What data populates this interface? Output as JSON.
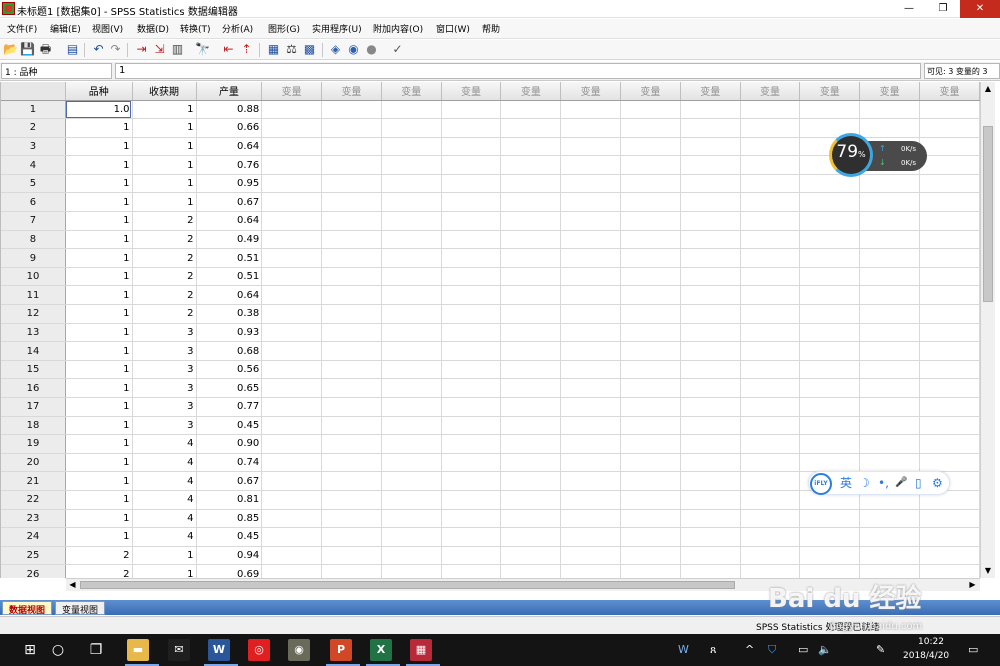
{
  "window": {
    "title": "未标题1 [数据集0] - SPSS Statistics 数据编辑器",
    "minimize": "—",
    "maximize": "❐",
    "close": "✕"
  },
  "menubar": [
    {
      "label": "文件(F)"
    },
    {
      "label": "编辑(E)"
    },
    {
      "label": "视图(V)"
    },
    {
      "label": "数据(D)"
    },
    {
      "label": "转换(T)"
    },
    {
      "label": "分析(A)"
    },
    {
      "label": "图形(G)"
    },
    {
      "label": "实用程序(U)"
    },
    {
      "label": "附加内容(O)"
    },
    {
      "label": "窗口(W)"
    },
    {
      "label": "帮助"
    }
  ],
  "toolbar": [
    {
      "icon": "open-icon",
      "glyph": "📂"
    },
    {
      "icon": "save-icon",
      "glyph": "💾"
    },
    {
      "icon": "print-icon",
      "glyph": "🖶"
    },
    {
      "icon": "dialog-recall-icon",
      "glyph": "▤"
    },
    {
      "icon": "undo-icon",
      "glyph": "↶"
    },
    {
      "icon": "redo-icon",
      "glyph": "↷"
    },
    {
      "icon": "goto-case-icon",
      "glyph": "⇥"
    },
    {
      "icon": "goto-variable-icon",
      "glyph": "⇲"
    },
    {
      "icon": "variables-icon",
      "glyph": "▥"
    },
    {
      "icon": "find-icon",
      "glyph": "🔭"
    },
    {
      "icon": "insert-cases-icon",
      "glyph": "⇤"
    },
    {
      "icon": "insert-variable-icon",
      "glyph": "⇡"
    },
    {
      "icon": "split-file-icon",
      "glyph": "▦"
    },
    {
      "icon": "weight-cases-icon",
      "glyph": "⚖"
    },
    {
      "icon": "select-cases-icon",
      "glyph": "▩"
    },
    {
      "icon": "value-labels-icon",
      "glyph": "◈"
    },
    {
      "icon": "use-sets-icon",
      "glyph": "◉"
    },
    {
      "icon": "show-all-icon",
      "glyph": "●"
    },
    {
      "icon": "spell-check-icon",
      "glyph": "✓"
    }
  ],
  "cellbar": {
    "cell_ref": "1 : 品种",
    "cell_value": "1",
    "visible_info": "可见: 3 变量的 3"
  },
  "grid": {
    "columns": [
      "品种",
      "收获期",
      "产量",
      "变量",
      "变量",
      "变量",
      "变量",
      "变量",
      "变量",
      "变量",
      "变量",
      "变量",
      "变量",
      "变量",
      "变量"
    ],
    "rows": [
      [
        "1",
        "1.0",
        "1",
        "0.88"
      ],
      [
        "2",
        "1",
        "1",
        "0.66"
      ],
      [
        "3",
        "1",
        "1",
        "0.64"
      ],
      [
        "4",
        "1",
        "1",
        "0.76"
      ],
      [
        "5",
        "1",
        "1",
        "0.95"
      ],
      [
        "6",
        "1",
        "1",
        "0.67"
      ],
      [
        "7",
        "1",
        "2",
        "0.64"
      ],
      [
        "8",
        "1",
        "2",
        "0.49"
      ],
      [
        "9",
        "1",
        "2",
        "0.51"
      ],
      [
        "10",
        "1",
        "2",
        "0.51"
      ],
      [
        "11",
        "1",
        "2",
        "0.64"
      ],
      [
        "12",
        "1",
        "2",
        "0.38"
      ],
      [
        "13",
        "1",
        "3",
        "0.93"
      ],
      [
        "14",
        "1",
        "3",
        "0.68"
      ],
      [
        "15",
        "1",
        "3",
        "0.56"
      ],
      [
        "16",
        "1",
        "3",
        "0.65"
      ],
      [
        "17",
        "1",
        "3",
        "0.77"
      ],
      [
        "18",
        "1",
        "3",
        "0.45"
      ],
      [
        "19",
        "1",
        "4",
        "0.90"
      ],
      [
        "20",
        "1",
        "4",
        "0.74"
      ],
      [
        "21",
        "1",
        "4",
        "0.67"
      ],
      [
        "22",
        "1",
        "4",
        "0.81"
      ],
      [
        "23",
        "1",
        "4",
        "0.85"
      ],
      [
        "24",
        "1",
        "4",
        "0.45"
      ],
      [
        "25",
        "2",
        "1",
        "0.94"
      ],
      [
        "26",
        "2",
        "1",
        "0.69"
      ]
    ]
  },
  "scrollbars": {
    "up": "▲",
    "down": "▼",
    "left": "◀",
    "right": "▶"
  },
  "view_tabs": {
    "data_view": "数据视图",
    "variable_view": "变量视图"
  },
  "status": {
    "text": "SPSS Statistics  处理器已就绪"
  },
  "speed_widget": {
    "percent": "79",
    "percent_sign": "%",
    "upload": "0K/s",
    "download": "0K/s",
    "up_arrow": "↑",
    "down_arrow": "↓"
  },
  "ime": {
    "logo": "iFLY",
    "lang": "英",
    "moon": "☽",
    "punct": "•,",
    "mic": "🎤",
    "keyboard": "▯",
    "settings": "⚙"
  },
  "taskbar": {
    "start": "⊞",
    "search": "○",
    "taskview": "❐",
    "apps": [
      {
        "name": "file-explorer",
        "glyph": "▬",
        "bg": "#e8b84a"
      },
      {
        "name": "mail",
        "glyph": "✉",
        "bg": "#1f1f1f"
      },
      {
        "name": "word",
        "glyph": "W",
        "bg": "#2b579a"
      },
      {
        "name": "netease-music",
        "glyph": "◎",
        "bg": "#e02020"
      },
      {
        "name": "photo-viewer",
        "glyph": "◉",
        "bg": "#6a6a5a"
      },
      {
        "name": "powerpoint",
        "glyph": "P",
        "bg": "#d24726"
      },
      {
        "name": "excel",
        "glyph": "X",
        "bg": "#217346"
      },
      {
        "name": "spss",
        "glyph": "▦",
        "bg": "#b82a3a"
      }
    ],
    "tray": {
      "people": "ጸ",
      "chevron": "^",
      "shield": "⛉",
      "battery": "▭",
      "volume": "🔈",
      "pen": "✎",
      "ime": "W",
      "time": "10:22",
      "date": "2018/4/20",
      "notifications": "▭"
    }
  },
  "watermark": {
    "brand": "Bai du 经验",
    "url": "jingyan.baidu.com"
  }
}
